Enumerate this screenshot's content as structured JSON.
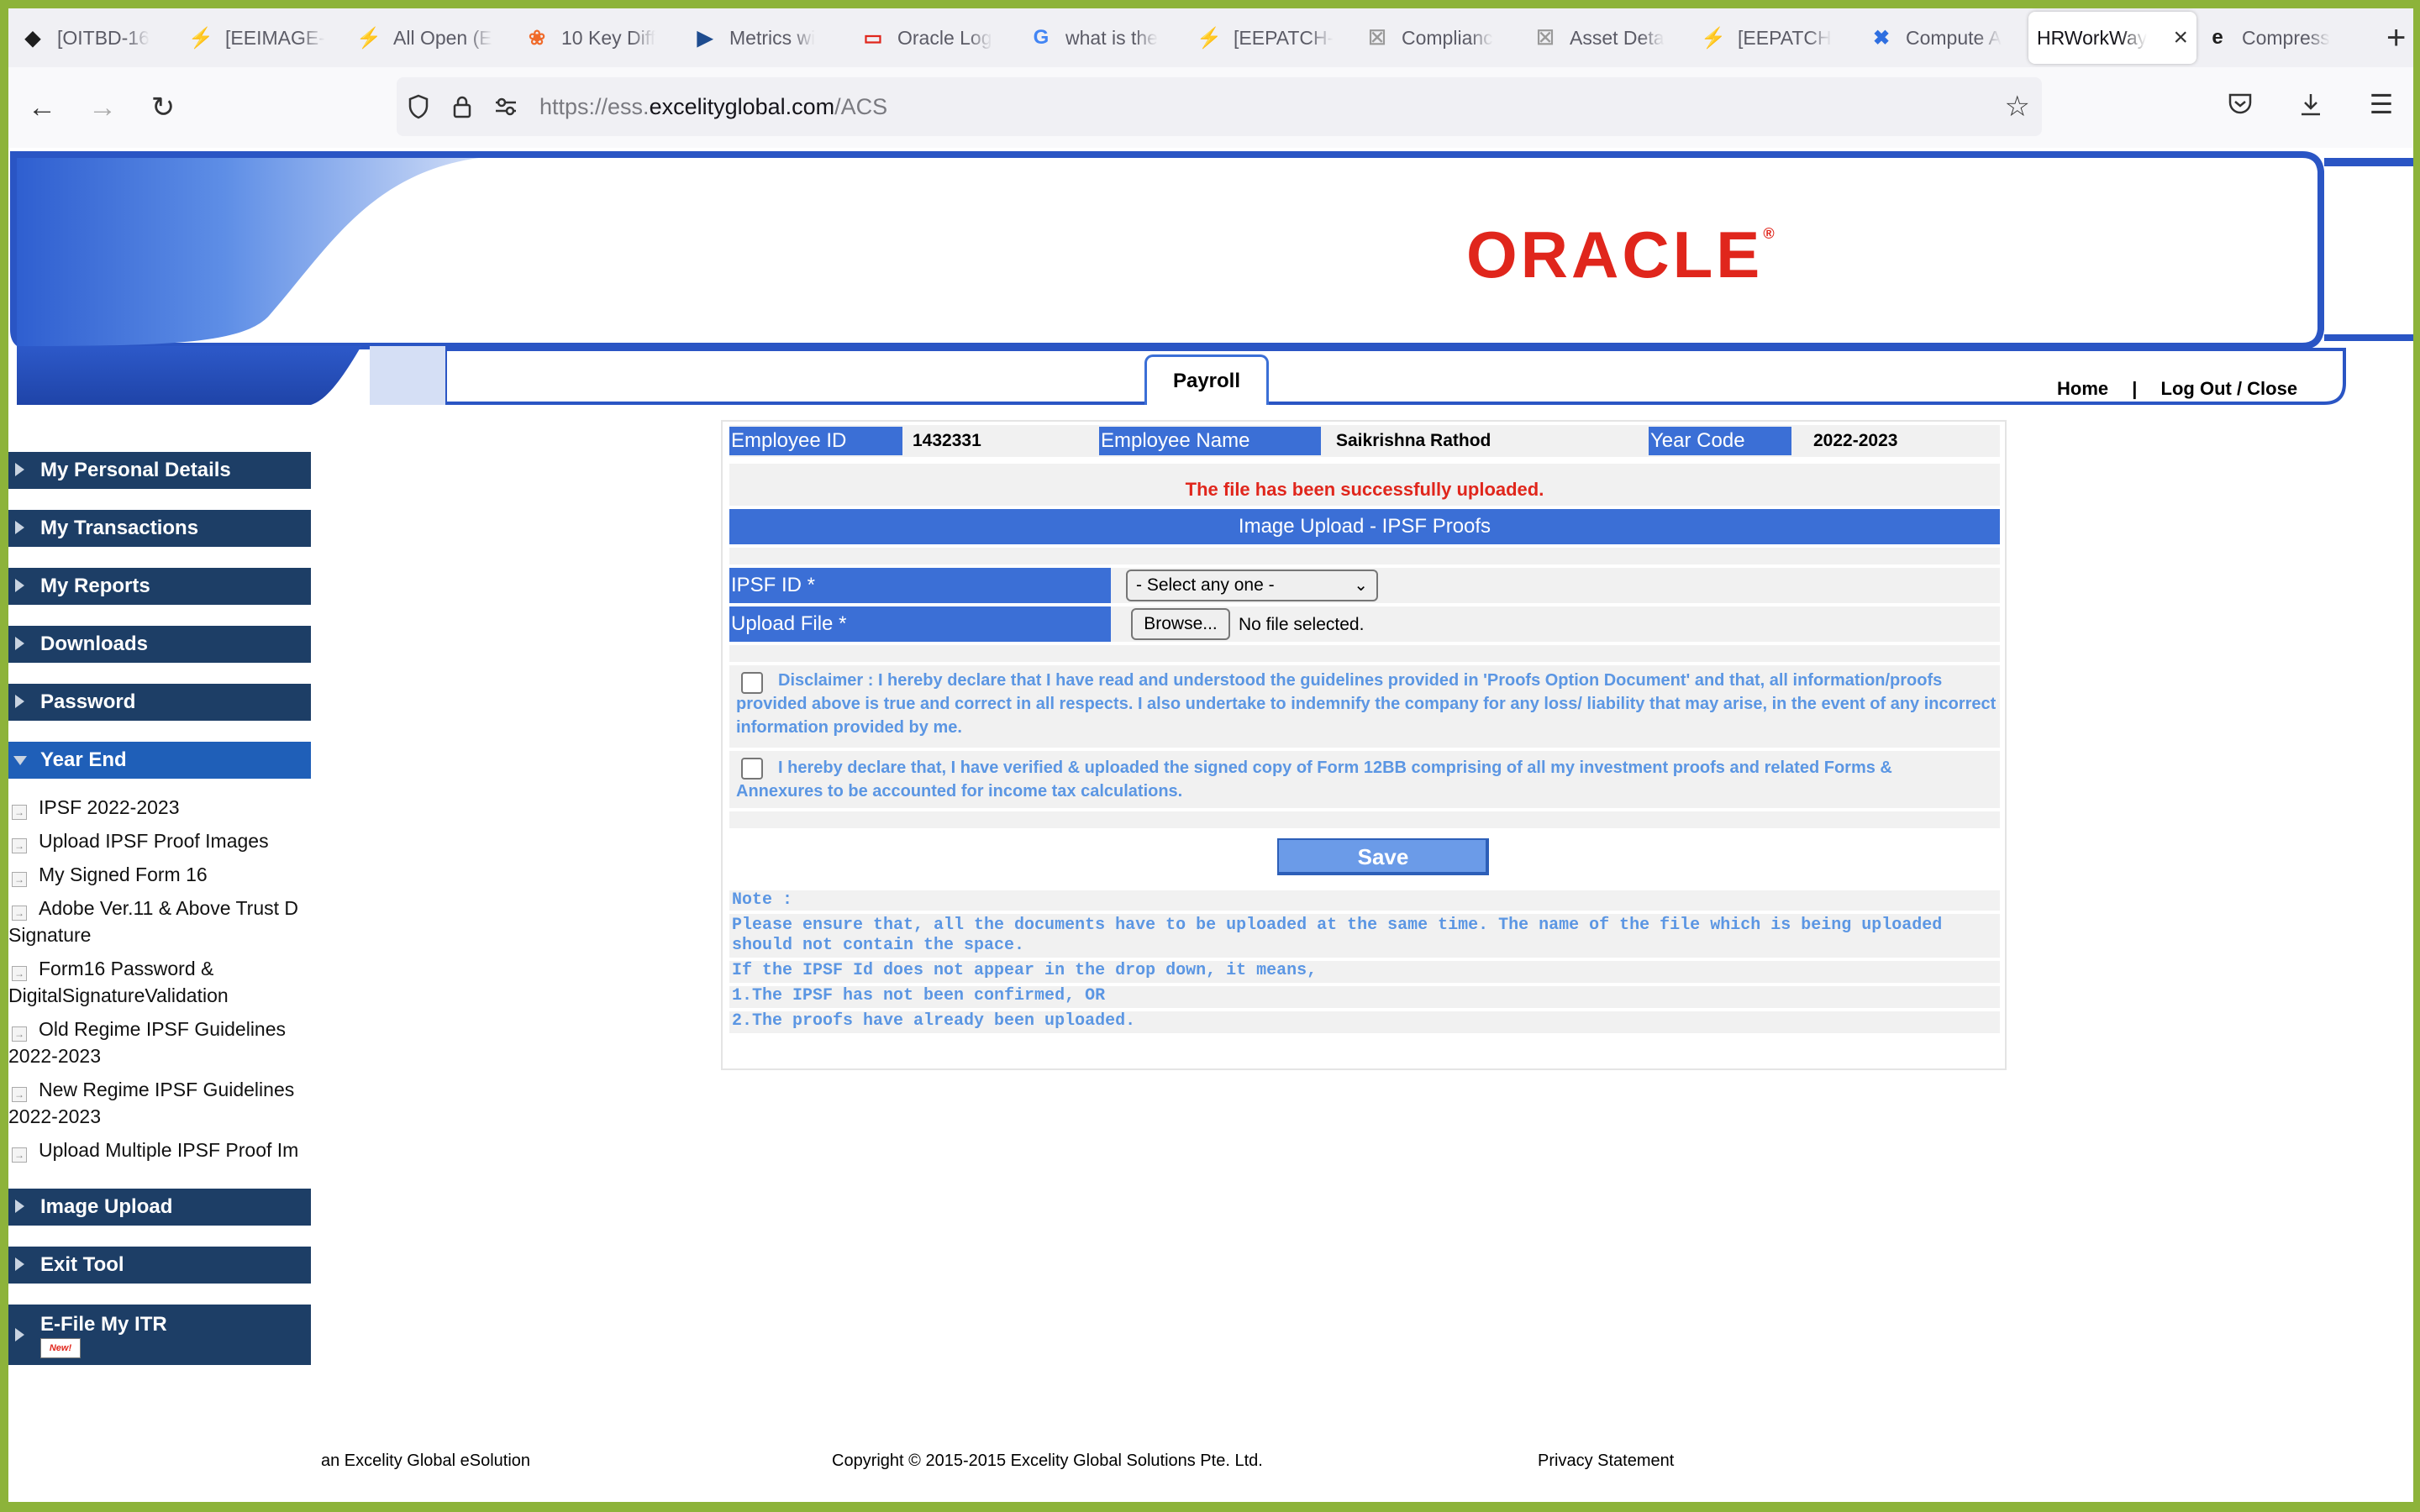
{
  "browser": {
    "tabs": [
      {
        "label": "[OITBD-16",
        "icon": "jira-diamond-icon",
        "color": "#1e1e1e"
      },
      {
        "label": "[EEIMAGE-",
        "icon": "jira-bolt-icon",
        "color": "#2f6fe0"
      },
      {
        "label": "All Open (E",
        "icon": "jira-bolt-icon",
        "color": "#2f6fe0"
      },
      {
        "label": "10 Key Diff",
        "icon": "blog-icon",
        "color": "#f06a2a"
      },
      {
        "label": "Metrics wi",
        "icon": "video-icon",
        "color": "#1e4c8f"
      },
      {
        "label": "Oracle Log",
        "icon": "oracle-icon",
        "color": "#e0261c"
      },
      {
        "label": "what is the",
        "icon": "google-icon",
        "color": "#4285f4"
      },
      {
        "label": "[EEPATCH-",
        "icon": "jira-bolt-icon",
        "color": "#2f6fe0"
      },
      {
        "label": "Complianc",
        "icon": "blank-page-icon",
        "color": "#999999"
      },
      {
        "label": "Asset Deta",
        "icon": "blank-page-icon",
        "color": "#999999"
      },
      {
        "label": "[EEPATCH",
        "icon": "jira-bolt-icon",
        "color": "#2f6fe0"
      },
      {
        "label": "Compute A",
        "icon": "confluence-icon",
        "color": "#2f6fe0"
      },
      {
        "label": "HRWorkWay",
        "icon": "none",
        "color": "#000000",
        "active": true
      },
      {
        "label": "Compress",
        "icon": "ev-icon",
        "color": "#1e1e1e"
      }
    ],
    "url_prefix": "https://ess.",
    "url_domain": "excelityglobal.com",
    "url_path": "/ACS"
  },
  "header": {
    "logo_text": "ORACLE",
    "active_tab": "Payroll",
    "home_link": "Home",
    "separator": "|",
    "logout_link": "Log Out / Close"
  },
  "sidebar": {
    "menus": [
      {
        "label": "My Personal Details"
      },
      {
        "label": "My Transactions"
      },
      {
        "label": "My Reports"
      },
      {
        "label": "Downloads"
      },
      {
        "label": "Password"
      }
    ],
    "year_end": {
      "label": "Year End",
      "items": [
        "IPSF 2022-2023",
        "Upload IPSF Proof Images",
        "My Signed Form 16",
        "Adobe Ver.11 & Above Trust D Signature",
        "Form16 Password & DigitalSignatureValidation",
        "Old Regime IPSF Guidelines 2022-2023",
        "New Regime IPSF Guidelines 2022-2023",
        "Upload Multiple IPSF Proof Im"
      ]
    },
    "bottom_menus": [
      {
        "label": "Image Upload"
      },
      {
        "label": "Exit Tool"
      }
    ],
    "efile": {
      "label": "E-File My ITR",
      "badge": "New!"
    }
  },
  "employee": {
    "id_label": "Employee ID",
    "id_value": "1432331",
    "name_label": "Employee Name",
    "name_value": "Saikrishna Rathod",
    "year_label": "Year Code",
    "year_value": "2022-2023"
  },
  "form": {
    "success_message": "The file has been successfully uploaded.",
    "section_title": "Image Upload - IPSF Proofs",
    "ipsf_label": "IPSF ID *",
    "ipsf_selected": "- Select any one -",
    "upload_label": "Upload File *",
    "browse_label": "Browse...",
    "file_status": "No file selected.",
    "disclaimer_1": "Disclaimer : I hereby declare that I have read and understood the guidelines provided in 'Proofs Option Document' and that, all information/proofs provided above is true and correct in all respects. I also undertake to indemnify the company for any loss/ liability that may arise, in the event of any incorrect information provided by me.",
    "disclaimer_2": "I hereby declare that, I have verified & uploaded the signed copy of Form 12BB comprising of all my investment proofs and related Forms & Annexures to be accounted for income tax calculations.",
    "save_label": "Save"
  },
  "notes": {
    "title": "Note :",
    "line1": "Please ensure that, all the documents have to be uploaded at the same time. The name of the file which is being uploaded should not contain the space.",
    "line2": "If the IPSF Id does not appear in the drop down, it means,",
    "line3": "1.The IPSF has not been confirmed, OR",
    "line4": "2.The proofs have already been uploaded."
  },
  "footer": {
    "left": "an Excelity Global eSolution",
    "center": "Copyright © 2015-2015 Excelity Global Solutions Pte. Ltd.",
    "right": "Privacy Statement"
  }
}
